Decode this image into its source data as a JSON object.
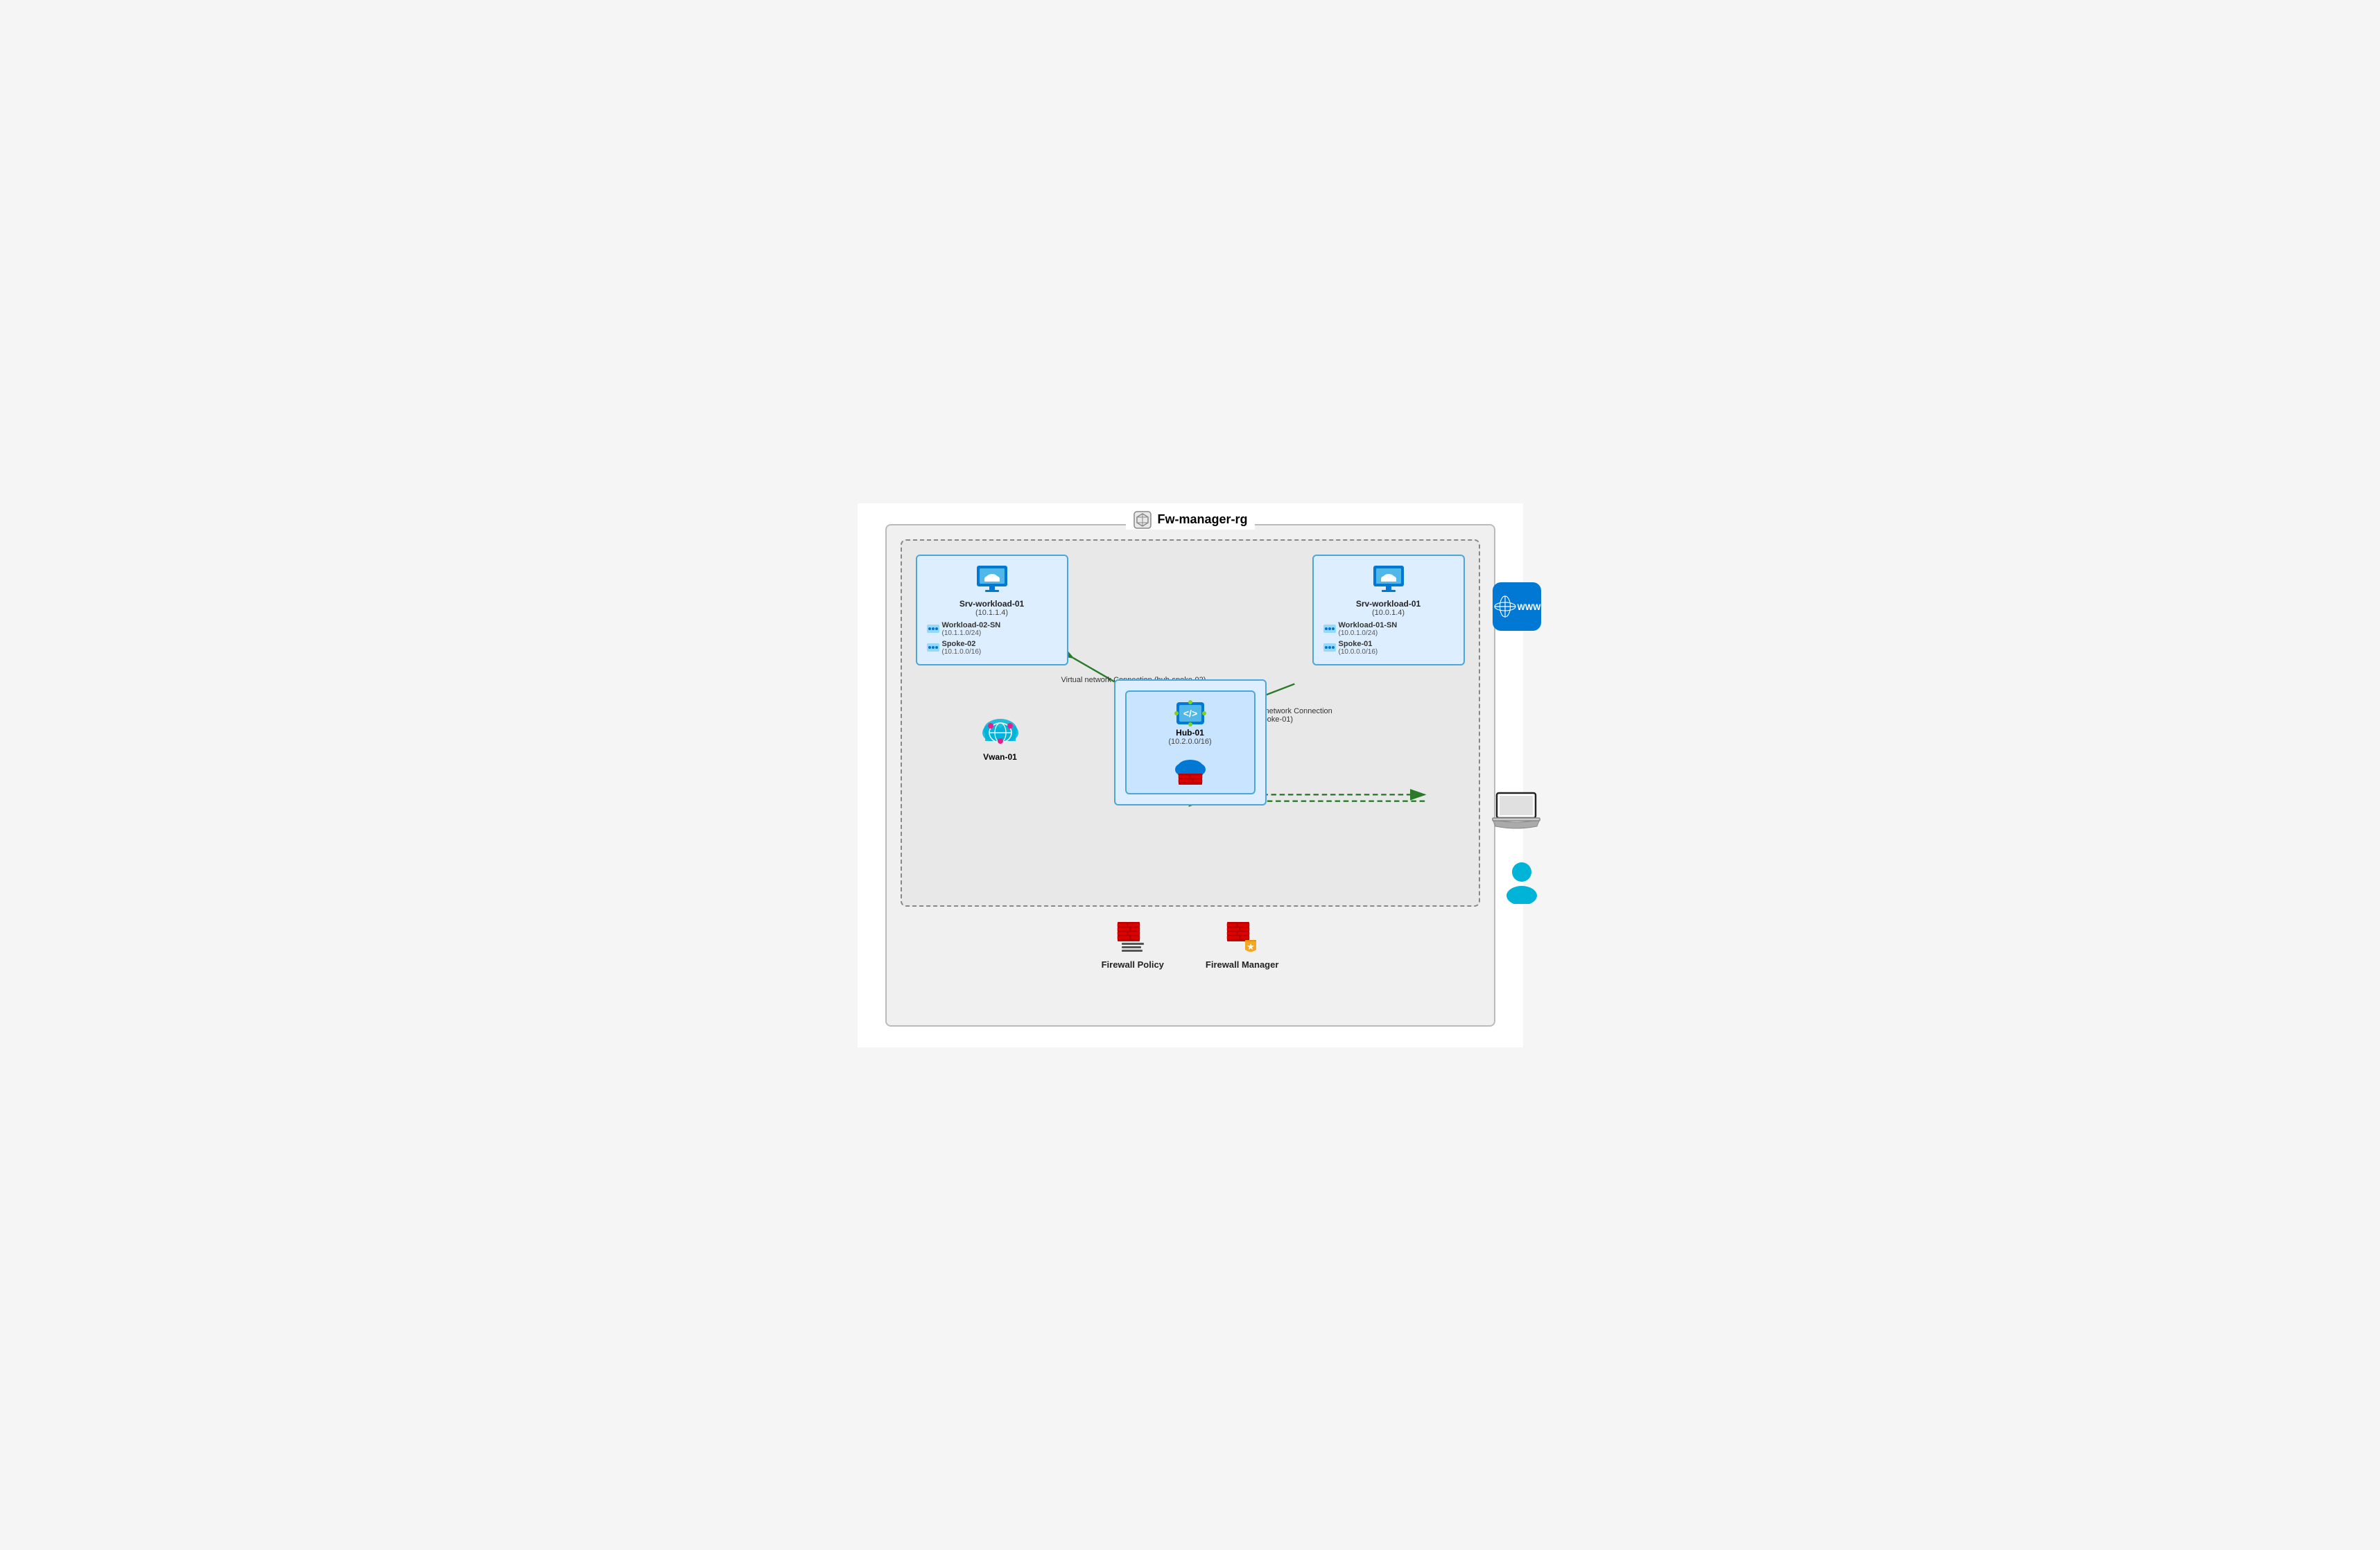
{
  "title": "Fw-manager-rg",
  "spoke_left": {
    "vm_label": "Srv-workload-01",
    "vm_ip": "(10.1.1.4)",
    "subnet_name": "Workload-02-SN",
    "subnet_ip": "(10.1.1.0/24)",
    "vnet_name": "Spoke-02",
    "vnet_ip": "(10.1.0.0/16)"
  },
  "spoke_right": {
    "vm_label": "Srv-workload-01",
    "vm_ip": "(10.0.1.4)",
    "subnet_name": "Workload-01-SN",
    "subnet_ip": "(10.0.1.0/24)",
    "vnet_name": "Spoke-01",
    "vnet_ip": "(10.0.0.0/16)"
  },
  "hub": {
    "label": "Hub-01",
    "ip": "(10.2.0.0/16)"
  },
  "vwan": {
    "label": "Vwan-01"
  },
  "connections": {
    "hub_spoke_02": "Virtual network\nConnection (hub-spoke-02)",
    "hub_spoke_01": "Virtual network Connection\n(hub-spoke-01)"
  },
  "www_label": "WWW",
  "bottom": {
    "firewall_policy_label": "Firewall Policy",
    "firewall_manager_label": "Firewall Manager"
  }
}
